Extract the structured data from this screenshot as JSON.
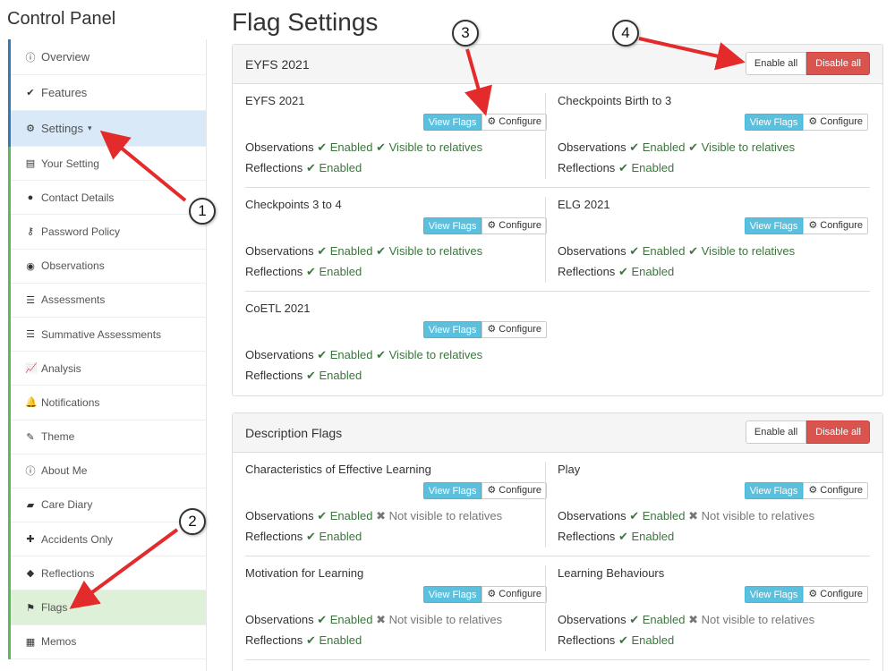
{
  "sidebar": {
    "title": "Control Panel",
    "top_items": [
      {
        "label": "Overview",
        "icon": "info-circle-icon",
        "glyph": "ⓘ"
      },
      {
        "label": "Features",
        "icon": "check-icon",
        "glyph": "✔"
      },
      {
        "label": "Settings",
        "icon": "gear-icon",
        "glyph": "⚙",
        "caret": "▾"
      }
    ],
    "sub_items": [
      {
        "label": "Your Setting",
        "icon": "document-icon",
        "glyph": "▤"
      },
      {
        "label": "Contact Details",
        "icon": "comment-icon",
        "glyph": "●"
      },
      {
        "label": "Password Policy",
        "icon": "key-icon",
        "glyph": "⚷"
      },
      {
        "label": "Observations",
        "icon": "eye-icon",
        "glyph": "◉"
      },
      {
        "label": "Assessments",
        "icon": "list-icon",
        "glyph": "☰"
      },
      {
        "label": "Summative Assessments",
        "icon": "list-icon",
        "glyph": "☰"
      },
      {
        "label": "Analysis",
        "icon": "line-chart-icon",
        "glyph": "📈"
      },
      {
        "label": "Notifications",
        "icon": "bell-icon",
        "glyph": "🔔"
      },
      {
        "label": "Theme",
        "icon": "brush-icon",
        "glyph": "✎"
      },
      {
        "label": "About Me",
        "icon": "info-circle-icon",
        "glyph": "ⓘ"
      },
      {
        "label": "Care Diary",
        "icon": "book-icon",
        "glyph": "▰"
      },
      {
        "label": "Accidents Only",
        "icon": "first-aid-icon",
        "glyph": "✚"
      },
      {
        "label": "Reflections",
        "icon": "bullhorn-icon",
        "glyph": "◆"
      },
      {
        "label": "Flags",
        "icon": "flag-icon",
        "glyph": "⚑"
      },
      {
        "label": "Memos",
        "icon": "newspaper-icon",
        "glyph": "▦"
      }
    ]
  },
  "page": {
    "title": "Flag Settings"
  },
  "labels": {
    "view_flags": "View Flags",
    "configure": "Configure",
    "enable_all": "Enable all",
    "disable_all": "Disable all",
    "observations": "Observations",
    "reflections": "Reflections",
    "enabled": "Enabled",
    "visible": "Visible to relatives",
    "not_visible": "Not visible to relatives"
  },
  "panels": [
    {
      "title": "EYFS 2021",
      "items": [
        {
          "name": "EYFS 2021",
          "visible": true
        },
        {
          "name": "Checkpoints Birth to 3",
          "visible": true
        },
        {
          "name": "Checkpoints 3 to 4",
          "visible": true
        },
        {
          "name": "ELG 2021",
          "visible": true
        },
        {
          "name": "CoETL 2021",
          "visible": true
        }
      ]
    },
    {
      "title": "Description Flags",
      "items": [
        {
          "name": "Characteristics of Effective Learning",
          "visible": false
        },
        {
          "name": "Play",
          "visible": false
        },
        {
          "name": "Motivation for Learning",
          "visible": false
        },
        {
          "name": "Learning Behaviours",
          "visible": false
        }
      ]
    }
  ],
  "callouts": [
    "1",
    "2",
    "3",
    "4"
  ],
  "colors": {
    "accent": "#e32b2b",
    "enabled": "#3c763d",
    "info": "#5bc0de",
    "danger": "#d9534f"
  }
}
